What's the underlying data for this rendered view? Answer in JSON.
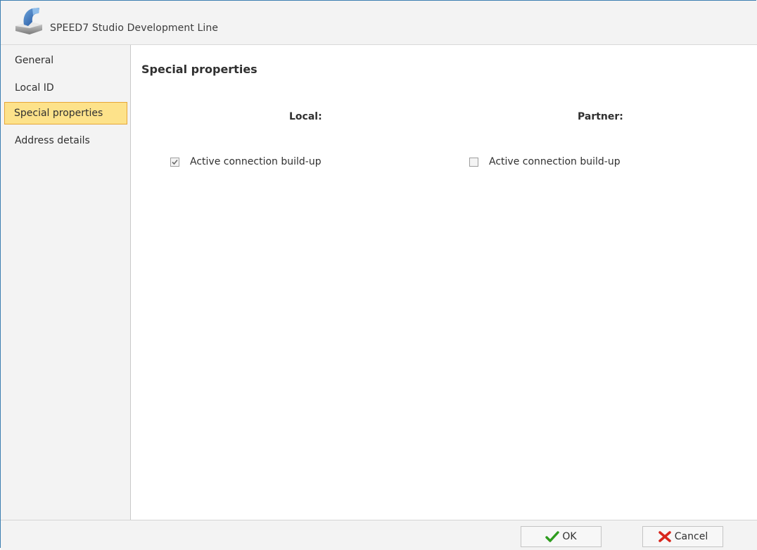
{
  "window": {
    "title": "SPEED7 Studio Development Line",
    "app_icon": "speed7-logo-icon"
  },
  "sidebar": {
    "items": [
      {
        "label": "General",
        "selected": false
      },
      {
        "label": "Local ID",
        "selected": false
      },
      {
        "label": "Special properties",
        "selected": true
      },
      {
        "label": "Address details",
        "selected": false
      }
    ]
  },
  "main": {
    "section_title": "Special properties",
    "local": {
      "heading": "Local:",
      "checkbox_label": "Active connection build-up",
      "checked": true
    },
    "partner": {
      "heading": "Partner:",
      "checkbox_label": "Active connection build-up",
      "checked": false
    }
  },
  "footer": {
    "ok_label": "OK",
    "ok_icon": "checkmark-icon",
    "ok_icon_color": "#2e9c1e",
    "cancel_label": "Cancel",
    "cancel_icon": "red-x-icon",
    "cancel_icon_color": "#d9261c"
  },
  "colors": {
    "accent_border": "#3c7fb1",
    "selected_bg": "#fde28a",
    "selected_border": "#e6a637"
  }
}
